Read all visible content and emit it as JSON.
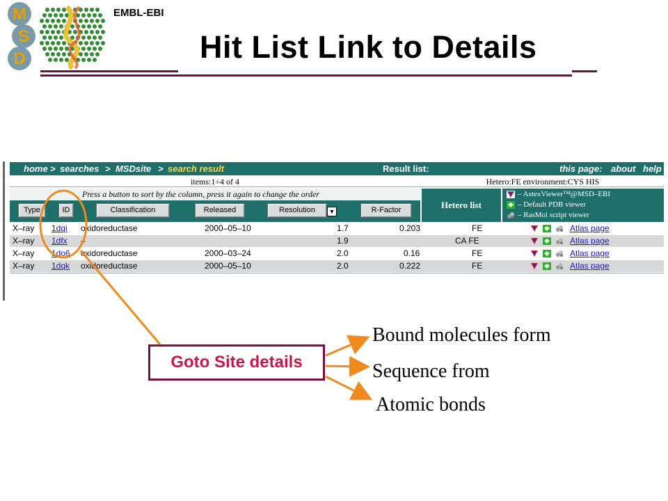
{
  "slide": {
    "org": "EMBL-EBI",
    "title": "Hit List Link to Details",
    "logo_letters": [
      "M",
      "S",
      "D"
    ]
  },
  "browser": {
    "nav": {
      "breadcrumb": [
        "home",
        "searches",
        "MSDsite",
        "search result"
      ],
      "separator": ">",
      "result_label": "Result list:",
      "links_label": "this page:",
      "links": [
        "about",
        "help"
      ]
    },
    "items_text": "items:1÷4 of 4",
    "hetero_info": "Hetero:FE environment:CYS HIS",
    "sort_hint": "Press a button to sort by the column, press it again to change the order",
    "sort_buttons": [
      "Type",
      "ID",
      "Classification",
      "Released",
      "Resolution",
      "R-Factor"
    ],
    "sort_arrow": "▼",
    "hetero_header": "Hetero list",
    "viewer_legend": [
      {
        "icon": "astexviewer-icon",
        "label": "– AstexViewer™@MSD–EBI"
      },
      {
        "icon": "pdb-viewer-icon",
        "label": "– Default PDB viewer"
      },
      {
        "icon": "rasmol-icon",
        "label": "– RasMol script viewer"
      }
    ],
    "rows": [
      {
        "type": "X–ray",
        "id": "1dqi",
        "classification": "oxidoreductase",
        "released": "2000–05–10",
        "resolution": "1.7",
        "rfactor": "0.203",
        "hetero": "FE",
        "atlas": "Atlas page"
      },
      {
        "type": "X–ray",
        "id": "1dfx",
        "classification": "–",
        "released": "",
        "resolution": "1.9",
        "rfactor": "",
        "hetero": "CA FE",
        "atlas": "Atlas page"
      },
      {
        "type": "X–ray",
        "id": "1do6",
        "classification": "oxidoreductase",
        "released": "2000–03–24",
        "resolution": "2.0",
        "rfactor": "0.16",
        "hetero": "FE",
        "atlas": "Atlas page"
      },
      {
        "type": "X–ray",
        "id": "1dqk",
        "classification": "oxidoreductase",
        "released": "2000–05–10",
        "resolution": "2.0",
        "rfactor": "0.222",
        "hetero": "FE",
        "atlas": "Atlas page"
      }
    ]
  },
  "callout": {
    "label": "Goto Site details",
    "options": [
      "Bound molecules form",
      "Sequence from",
      "Atomic bonds"
    ]
  },
  "colors": {
    "accent_maroon": "#6b1040",
    "callout_text": "#c8174a",
    "arrow_orange": "#f08a1e",
    "table_teal": "#1e6f6a",
    "breadcrumb_current": "#ffd84a"
  }
}
